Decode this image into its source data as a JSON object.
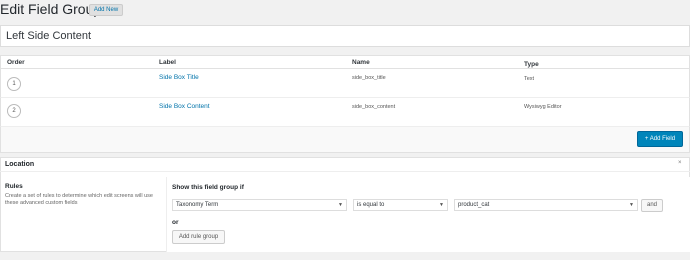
{
  "header": {
    "title": "Edit Field Group",
    "add_new_label": "Add New"
  },
  "field_group_title": "Left Side Content",
  "fields_table": {
    "columns": [
      "Order",
      "Label",
      "Name",
      "Type"
    ],
    "rows": [
      {
        "order": "1",
        "label": "Side Box Title",
        "name": "side_box_title",
        "type": "Text"
      },
      {
        "order": "2",
        "label": "Side Box Content",
        "name": "side_box_content",
        "type": "Wysiwyg Editor"
      }
    ],
    "add_field_label": "+ Add Field"
  },
  "location": {
    "title": "Location",
    "toggle_icon": "×",
    "rules_label": "Rules",
    "rules_description": "Create a set of rules to determine which edit screens will use these advanced custom fields",
    "show_if_label": "Show this field group if",
    "param_value": "Taxonomy Term",
    "operator_value": "is equal to",
    "value_value": "product_cat",
    "and_label": "and",
    "or_label": "or",
    "add_rule_group_label": "Add rule group"
  }
}
